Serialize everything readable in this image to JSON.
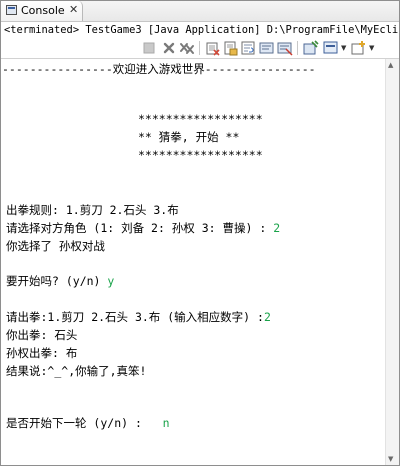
{
  "tab": {
    "label": "Console",
    "close_glyph": "✕",
    "icon": "console-icon"
  },
  "status_line": "<terminated> TestGame3 [Java Application] D:\\ProgramFile\\MyEclipse10\\Co",
  "toolbar": {
    "icons": [
      "stop-icon",
      "remove-launch-icon",
      "remove-all-launches-icon",
      "clear-console-icon",
      "scroll-lock-icon",
      "word-wrap-icon",
      "show-on-output-icon",
      "show-on-error-icon",
      "pin-console-icon",
      "display-selected-console-icon",
      "open-console-icon"
    ]
  },
  "console": {
    "header": "----------------欢迎进入游戏世界----------------",
    "stars_top": "******************",
    "banner": "** 猜拳, 开始 **",
    "stars_bottom": "******************",
    "rules": "出拳规则: 1.剪刀 2.石头 3.布",
    "choose_opponent": "请选择对方角色 (1: 刘备 2: 孙权 3: 曹操) : ",
    "choose_opponent_input": "2",
    "you_chose": "你选择了 孙权对战",
    "start_prompt": "要开始吗? (y/n) ",
    "start_input": "y",
    "punch_prompt": "请出拳:1.剪刀 2.石头 3.布 (输入相应数字) :",
    "punch_input": "2",
    "your_punch": "你出拳: 石头",
    "opponent_punch": "孙权出拳: 布",
    "result": "结果说:^_^,你输了,真笨!",
    "next_round_prompt": "是否开始下一轮 (y/n) :   ",
    "next_round_input": "n"
  }
}
